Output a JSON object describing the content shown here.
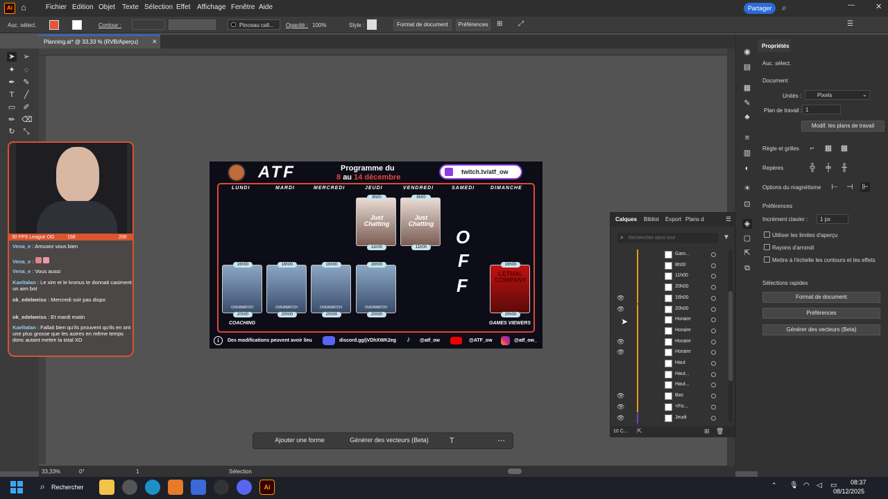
{
  "app": {
    "name": "Ai",
    "share_label": "Partager"
  },
  "menu": [
    "Fichier",
    "Edition",
    "Objet",
    "Texte",
    "Sélection",
    "Effet",
    "Affichage",
    "Fenêtre",
    "Aide"
  ],
  "control_bar": {
    "selection_label": "Auc. sélect.",
    "stroke_label": "Contour :",
    "brush_label": "Pinceau call...",
    "opacity_label": "Opacité :",
    "opacity_value": "100%",
    "style_label": "Style :",
    "doc_format_button": "Format de document",
    "preferences_button": "Préférences"
  },
  "document_tab": {
    "title": "Planning.ai* @ 33,33 % (RVB/Aperçu)"
  },
  "status": {
    "zoom": "33,33%",
    "rotation": "0°",
    "artboard": "1",
    "mode": "Sélection"
  },
  "context_bar": {
    "add_shape": "Ajouter une forme",
    "generate_vectors": "Générer des vecteurs (Beta)"
  },
  "artboard": {
    "logo_text": "ATF",
    "program_title": "Programme du",
    "program_dates_from": "8",
    "program_dates_mid": "au",
    "program_dates_to": "14 décembre",
    "twitch": "twitch.tv/atf_ow",
    "days": [
      "LUNDI",
      "MARDI",
      "MERCREDI",
      "JEUDI",
      "VENDREDI",
      "SAMEDI",
      "DIMANCHE"
    ],
    "just_chatting": "Just Chatting",
    "times": {
      "t8": "8h00",
      "t11": "11h00",
      "t16": "16h00",
      "t20": "20h00"
    },
    "off_letters": [
      "O",
      "F",
      "F"
    ],
    "coaching": "COACHING",
    "games_viewers": "GAMES VIEWERS",
    "overwatch": "OVERWATCH",
    "lethal_company": "LETHAL COMPANY",
    "footer": {
      "info": "Des modifications peuvent avoir lieu",
      "discord": "discord.gg/jVDhXWK2eg",
      "tiktok": "@atf_ow",
      "youtube": "@ATF_ow",
      "instagram": "@atf_ow_"
    }
  },
  "layers_panel": {
    "tabs": [
      "Calques",
      "Bibliot",
      "Export",
      "Plans d"
    ],
    "search_placeholder": "Rechercher dans tout",
    "rows": [
      "Gam...",
      "8h00",
      "11h00",
      "20h00",
      "16h00",
      "20h00",
      "Horaire",
      "Horaire",
      "Horaire",
      "Horaire",
      "Haut",
      "Haut...",
      "Haut...",
      "Bas",
      "<Fic...",
      "Jeudi"
    ],
    "footer_count": "10 C..."
  },
  "properties_panel": {
    "title": "Propriétés",
    "selection": "Auc. sélect.",
    "document_section": "Document",
    "units_label": "Unités :",
    "units_value": "Pixels",
    "artboard_label": "Plan de travail :",
    "artboard_value": "1",
    "edit_artboards_button": "Modif. les plans de travail",
    "rulers_label": "Règle et grilles",
    "guides_label": "Repères",
    "snap_label": "Options du magnétisme",
    "prefs_section": "Préférences",
    "keyboard_increment_label": "Incrément clavier :",
    "keyboard_increment_value": "1 px",
    "use_preview_bounds": "Utiliser les limites d'aperçu",
    "rounded_corners": "Rayons d'arrondi",
    "scale_strokes": "Mettre à l'échelle les contours et les effets",
    "quick_actions": "Sélections rapides",
    "qa_doc_format": "Format de document",
    "qa_preferences": "Préférences",
    "qa_generate_vectors": "Générer des vecteurs (Beta)"
  },
  "webcam": {
    "overlay_left": "30 FPS League OG",
    "overlay_mid": "156",
    "overlay_right": "200"
  },
  "chat": [
    {
      "user": "Vena_e",
      "msg": " : Amusez vous bien"
    },
    {
      "user": "Vena_e",
      "msg": " :"
    },
    {
      "user": "Vena_e",
      "msg": " : Vous aussi"
    },
    {
      "user": "Kaeltalan",
      "msg": " : Le xim et le kronus te donnait casiment un aim bot"
    },
    {
      "user": "ok_edelweiss",
      "msg": " : Mercredi soir pas dispo"
    },
    {
      "user": "ok_edelweiss",
      "msg": " : Et mardi matin"
    },
    {
      "user": "Kaeltalan",
      "msg": " : Fallait bien qu'ils prouvent qu'ils en ont une plus grosse que les autres en même temps donc autant mettre la total XD"
    }
  ],
  "taskbar": {
    "search": "Rechercher",
    "time": "08:37",
    "date": "08/12/2025"
  },
  "colors": {
    "accent": "#2b6bd8",
    "orange": "#e79b1a",
    "stream_frame": "#d9542f",
    "artboard_red": "#e2473a"
  }
}
